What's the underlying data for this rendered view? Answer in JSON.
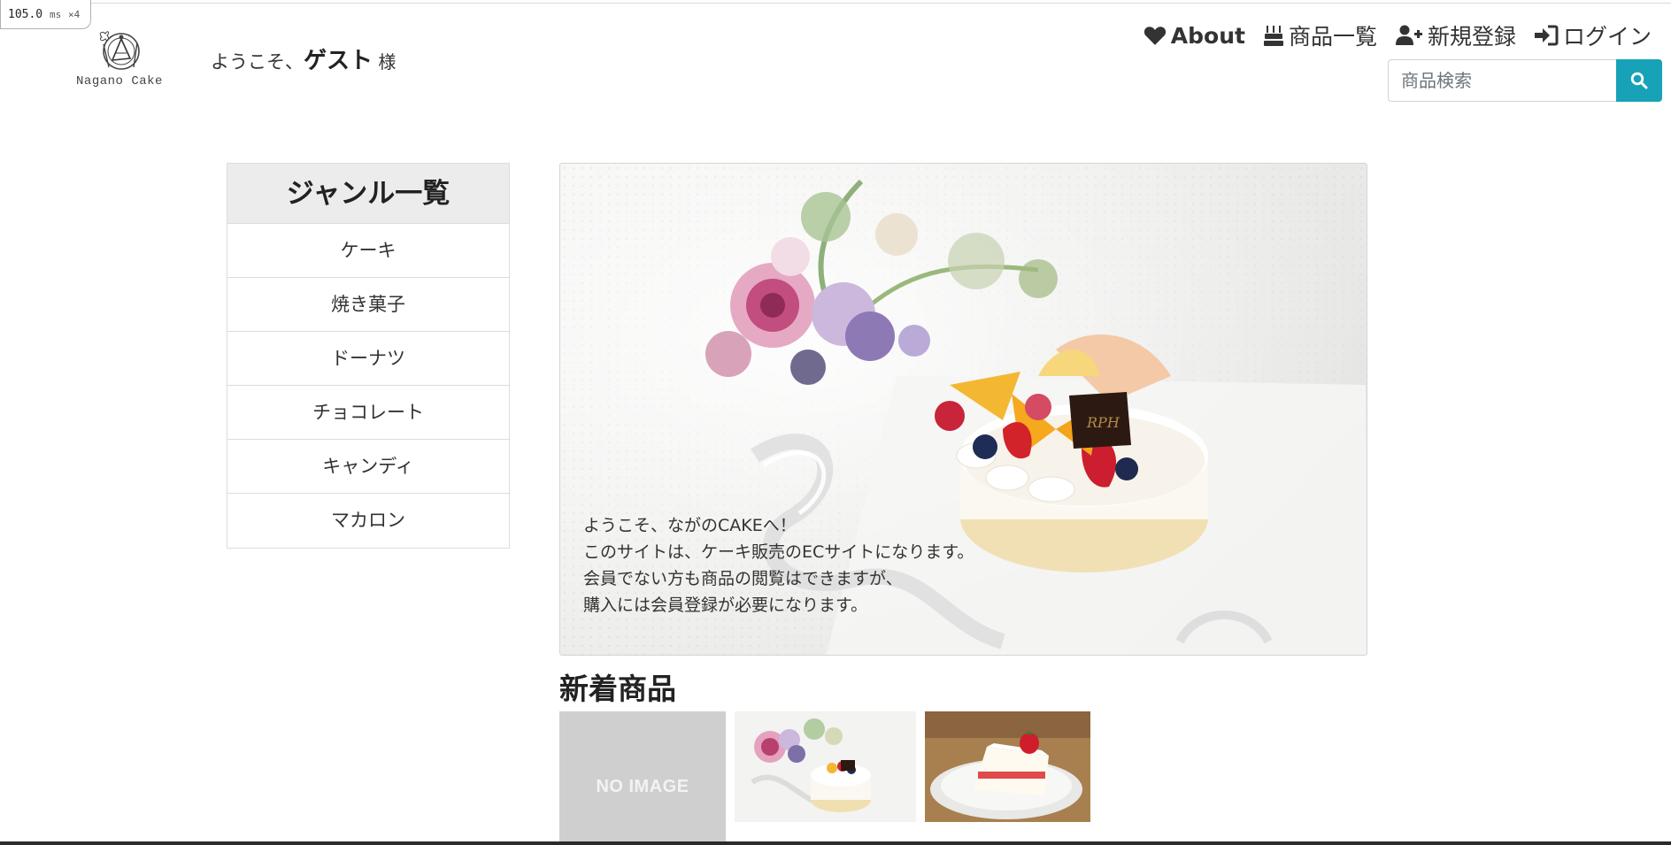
{
  "perf": {
    "value": "105.0",
    "unit": "ms",
    "multiplier": "×4"
  },
  "header": {
    "logo_text": "Nagano Cake",
    "welcome_prefix": "ようこそ、",
    "welcome_name": "ゲスト",
    "welcome_suffix": " 様"
  },
  "nav": {
    "about": "About",
    "products": "商品一覧",
    "register": "新規登録",
    "login": "ログイン"
  },
  "search": {
    "placeholder": "商品検索"
  },
  "genre": {
    "title": "ジャンル一覧",
    "items": [
      "ケーキ",
      "焼き菓子",
      "ドーナツ",
      "チョコレート",
      "キャンディ",
      "マカロン"
    ]
  },
  "hero": {
    "lines": [
      "ようこそ、ながのCAKEへ！",
      "このサイトは、ケーキ販売のECサイトになります。",
      "会員でない方も商品の閲覧はできますが、",
      "購入には会員登録が必要になります。"
    ]
  },
  "new_items": {
    "title": "新着商品",
    "no_image_label": "NO IMAGE"
  },
  "colors": {
    "search_button": "#17a2b8",
    "no_image_bg": "#cfcfcf"
  }
}
